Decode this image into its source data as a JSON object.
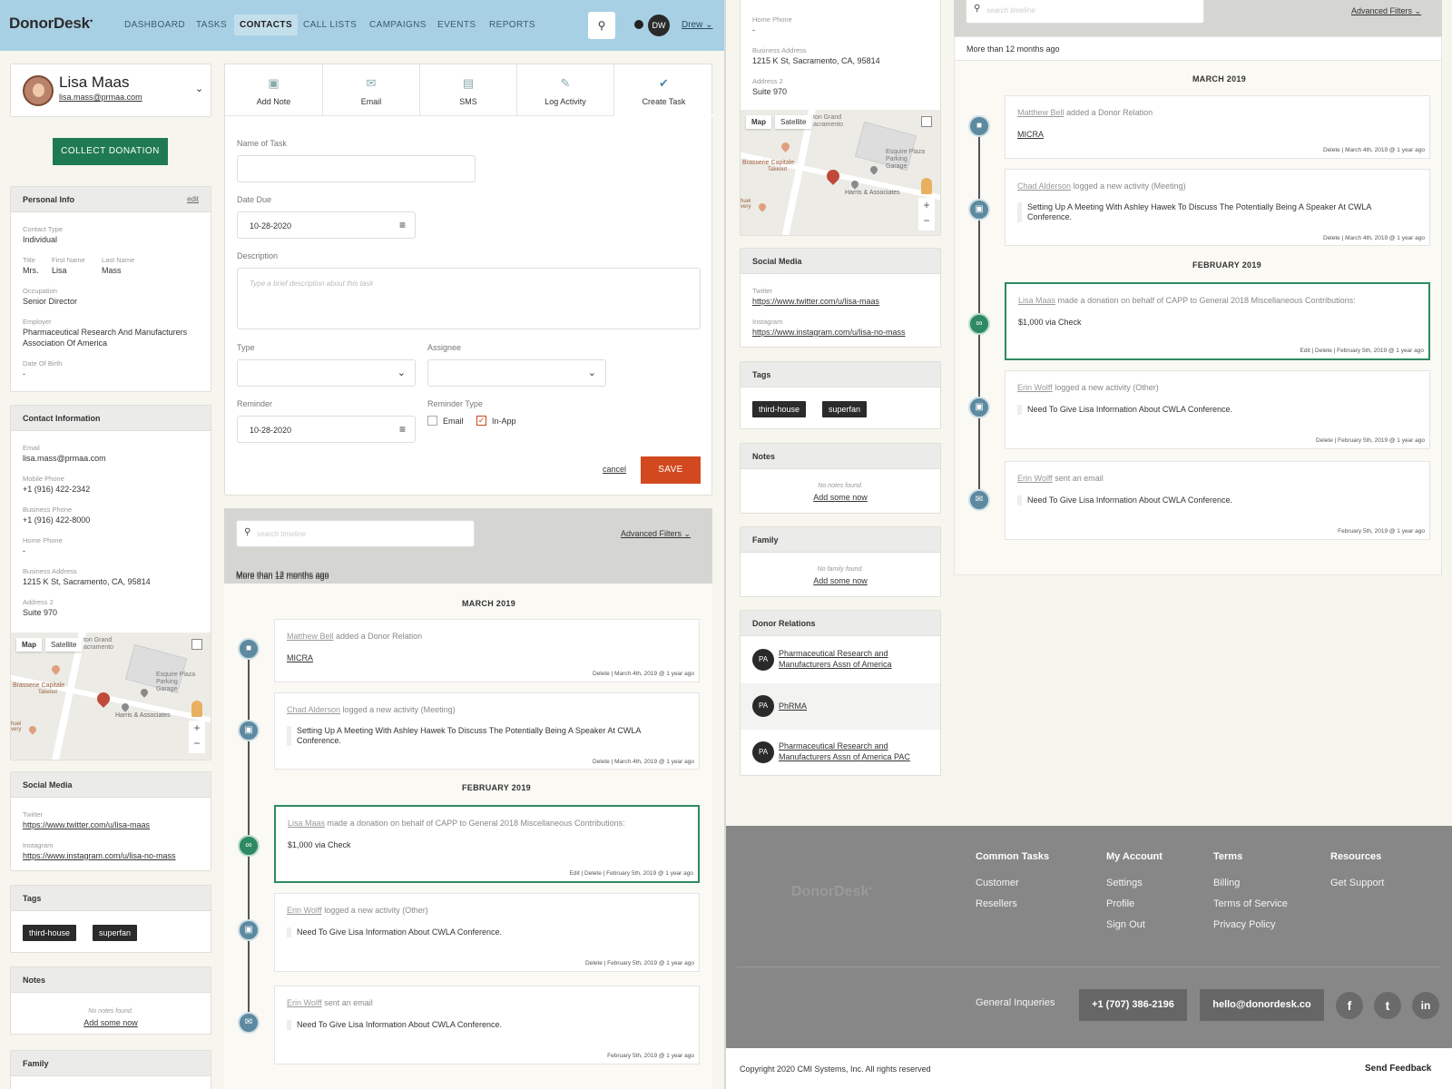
{
  "nav": {
    "logo": "DonorDesk",
    "items": [
      "DASHBOARD",
      "TASKS",
      "CONTACTS",
      "CALL LISTS",
      "CAMPAIGNS",
      "EVENTS",
      "REPORTS"
    ],
    "avatar": "DW",
    "user": "Drew"
  },
  "contact": {
    "name": "Lisa Maas",
    "email": "lisa.mass@prmaa.com",
    "collect": "COLLECT DONATION"
  },
  "personal": {
    "title": "Personal Info",
    "edit": "edit",
    "contact_type_label": "Contact Type",
    "contact_type": "Individual",
    "title_label": "Title",
    "title_val": "Mrs.",
    "first_label": "First Name",
    "first": "Lisa",
    "last_label": "Last Name",
    "last": "Mass",
    "occupation_label": "Occupation",
    "occupation": "Senior Director",
    "employer_label": "Employer",
    "employer": "Pharmaceutical Research And Manufacturers Association Of America",
    "dob_label": "Date Of Birth",
    "dob": "-"
  },
  "contactinfo": {
    "title": "Contact Information",
    "email_label": "Email",
    "email": "lisa.mass@prmaa.com",
    "mobile_label": "Mobile Phone",
    "mobile": "+1 (916) 422-2342",
    "business_label": "Business Phone",
    "business": "+1 (916) 422-8000",
    "home_label": "Home Phone",
    "home": "-",
    "addr_label": "Business Address",
    "addr": "1215 K St, Sacramento, CA, 95814",
    "addr2_label": "Address 2",
    "addr2": "Suite 970"
  },
  "map": {
    "map": "Map",
    "satellite": "Satellite",
    "place1": "ton Grand acramento",
    "place2": "Esquire Plaza Parking Garage",
    "place3": "Brasserie Capitale",
    "place3b": "Takeout",
    "place4": "Harris & Associates",
    "place5": "huel very",
    "plus": "+",
    "minus": "−"
  },
  "social": {
    "title": "Social Media",
    "twitter_label": "Twitter",
    "twitter": "https://www.twitter.com/u/lisa-maas",
    "insta_label": "Instagram",
    "insta": "https://www.instagram.com/u/lisa-no-mass"
  },
  "tags": {
    "title": "Tags",
    "items": [
      "third-house",
      "superfan"
    ]
  },
  "notes": {
    "title": "Notes",
    "empty": "No notes found.",
    "add": "Add some now"
  },
  "family": {
    "title": "Family",
    "empty": "No family found.",
    "add": "Add some now"
  },
  "relations": {
    "title": "Donor Relations",
    "items": [
      {
        "initials": "PA",
        "name": "Pharmaceutical Research and Manufacturers Assn of America"
      },
      {
        "initials": "PA",
        "name": "PhRMA"
      },
      {
        "initials": "PA",
        "name": "Pharmaceutical Research and Manufacturers Assn of America PAC"
      }
    ]
  },
  "actions": {
    "tabs": [
      "Add Note",
      "Email",
      "SMS",
      "Log Activity",
      "Create Task"
    ]
  },
  "form": {
    "name_label": "Name of Task",
    "date_label": "Date Due",
    "date": "10-28-2020",
    "desc_label": "Description",
    "desc_ph": "Type a brief description about this task",
    "type_label": "Type",
    "assignee_label": "Assignee",
    "reminder_label": "Reminder",
    "reminder": "10-28-2020",
    "rtype_label": "Reminder Type",
    "opt_email": "Email",
    "opt_inapp": "In-App",
    "cancel": "cancel",
    "save": "SAVE"
  },
  "timeline": {
    "search_ph": "search timeline",
    "filters": "Advanced Filters",
    "period": "More than 12 months ago",
    "month1": "MARCH 2019",
    "month2": "FEBRUARY 2019",
    "entries": [
      {
        "who": "Matthew Bell",
        "action": "added a Donor Relation",
        "body": "MICRA",
        "meta": "Delete | March 4th, 2019 @ 1 year ago"
      },
      {
        "who": "Chad Alderson",
        "action": "logged a new activity (Meeting)",
        "body": "Setting Up A Meeting With Ashley Hawek To Discuss The Potentially Being A Speaker At CWLA Conference.",
        "meta": "Delete | March 4th, 2019 @ 1 year ago"
      },
      {
        "who": "Lisa Maas",
        "action": "made a donation on behalf of CAPP to General 2018 Miscellaneous Contributions:",
        "body": "$1,000 via Check",
        "meta": "Edit | Delete | February 5th, 2019 @ 1 year ago"
      },
      {
        "who": "Erin Wolff",
        "action": "logged a new activity (Other)",
        "body": "Need To Give Lisa Information About CWLA Conference.",
        "meta": "Delete | February 5th, 2019 @ 1 year ago"
      },
      {
        "who": "Erin Wolff",
        "action": "sent an email",
        "body": "Need To Give Lisa Information About CWLA Conference.",
        "meta": "February 5th, 2019 @ 1 year ago"
      }
    ]
  },
  "footer": {
    "logo": "DonorDesk",
    "col1": {
      "h": "Common Tasks",
      "items": [
        "Customer",
        "Resellers"
      ]
    },
    "col2": {
      "h": "My Account",
      "items": [
        "Settings",
        "Profile",
        "Sign Out"
      ]
    },
    "col3": {
      "h": "Terms",
      "items": [
        "Billing",
        "Terms of Service",
        "Privacy Policy"
      ]
    },
    "col4": {
      "h": "Resources",
      "items": [
        "Get Support"
      ]
    },
    "inq": "General Inqueries",
    "phone": "+1 (707) 386-2196",
    "email": "hello@donordesk.co",
    "social": [
      "f",
      "t",
      "in"
    ],
    "copyright": "Copyright 2020 CMI Systems, Inc. All rights reserved",
    "feedback": "Send Feedback"
  }
}
